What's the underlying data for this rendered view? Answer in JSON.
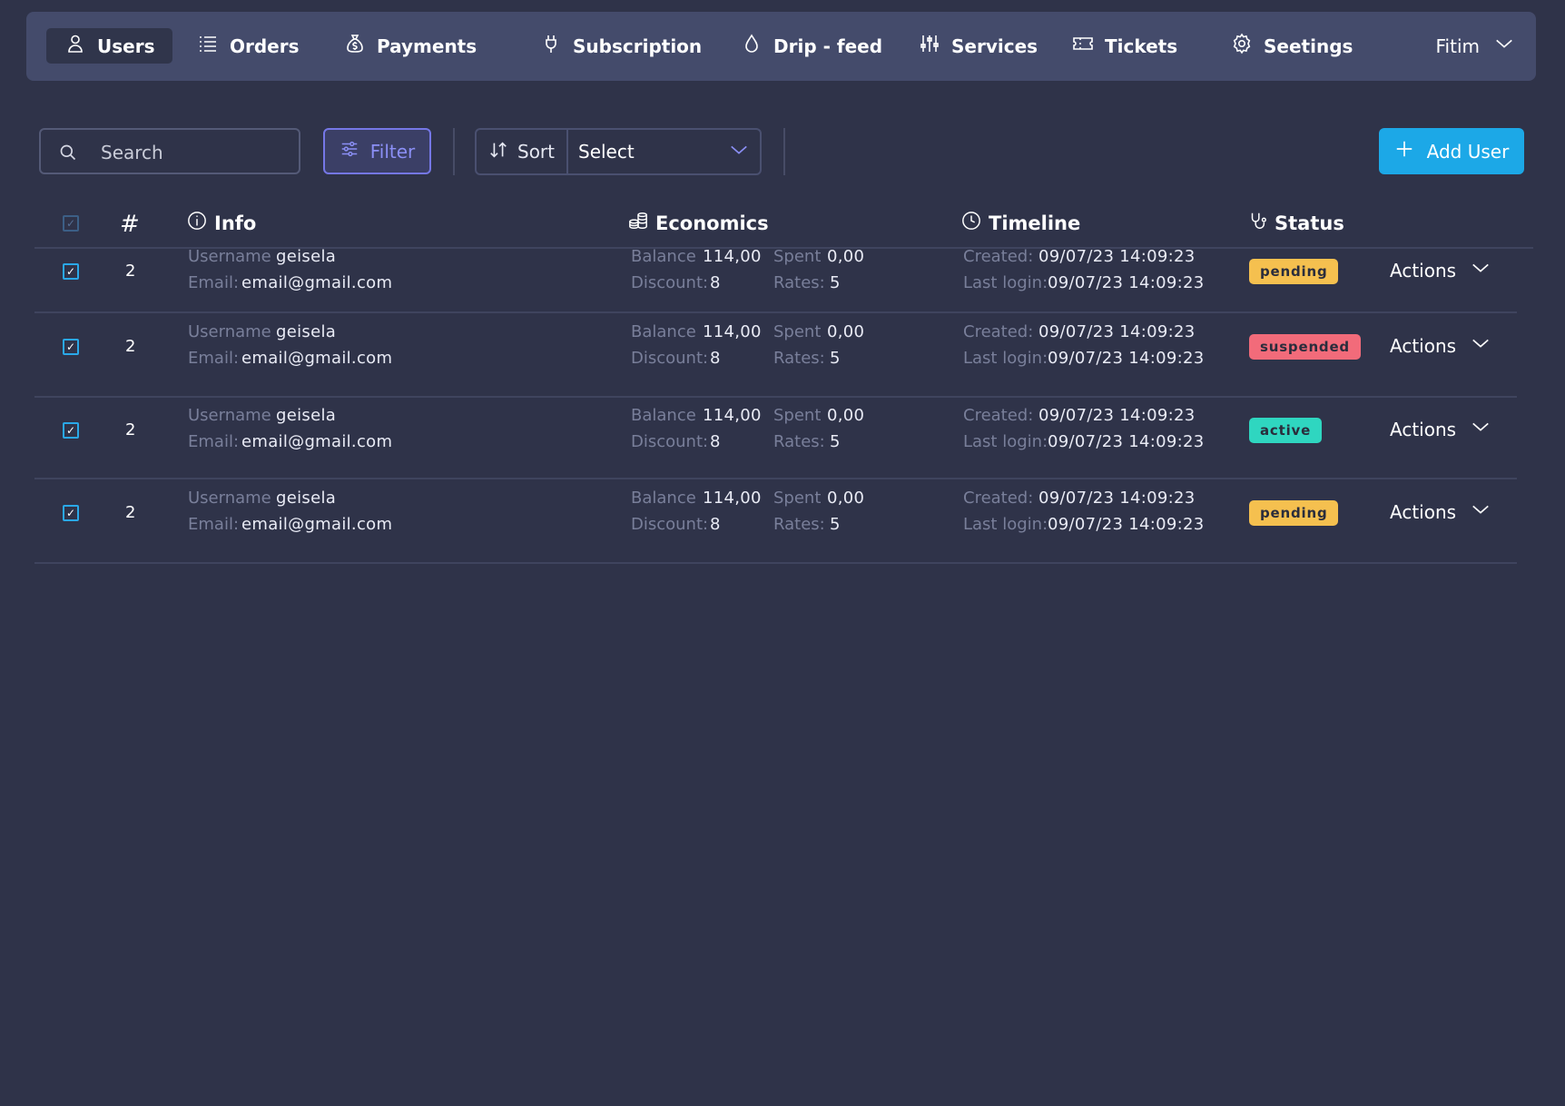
{
  "nav": {
    "items": [
      {
        "label": "Users",
        "icon": "user-icon"
      },
      {
        "label": "Orders",
        "icon": "list-icon"
      },
      {
        "label": "Payments",
        "icon": "money-bag-icon"
      },
      {
        "label": "Subscription",
        "icon": "plug-icon"
      },
      {
        "label": "Drip - feed",
        "icon": "drop-icon"
      },
      {
        "label": "Services",
        "icon": "sliders-icon"
      },
      {
        "label": "Tickets",
        "icon": "ticket-icon"
      },
      {
        "label": "Seetings",
        "icon": "gear-icon"
      }
    ],
    "active_index": 0,
    "user_name": "Fitim"
  },
  "toolbar": {
    "search_placeholder": "Search",
    "filter_label": "Filter",
    "sort_label": "Sort",
    "sort_select_value": "Select",
    "add_button_label": "Add User"
  },
  "table": {
    "headers": {
      "number": "#",
      "info": "Info",
      "economics": "Economics",
      "timeline": "Timeline",
      "status": "Status"
    },
    "labels": {
      "username": "Username",
      "email": "Email:",
      "balance": "Balance",
      "discount": "Discount:",
      "spent": "Spent",
      "rates": "Rates:",
      "created": "Created:",
      "last_login": "Last login:",
      "actions": "Actions"
    },
    "rows": [
      {
        "id": "2",
        "username": "geisela",
        "email": "email@gmail.com",
        "balance": "114,00",
        "discount": "8",
        "spent": "0,00",
        "rates": "5",
        "created": "09/07/23 14:09:23",
        "last_login": "09/07/23 14:09:23",
        "status": "pending",
        "checked": true
      },
      {
        "id": "2",
        "username": "geisela",
        "email": "email@gmail.com",
        "balance": "114,00",
        "discount": "8",
        "spent": "0,00",
        "rates": "5",
        "created": "09/07/23 14:09:23",
        "last_login": "09/07/23 14:09:23",
        "status": "suspended",
        "checked": true
      },
      {
        "id": "2",
        "username": "geisela",
        "email": "email@gmail.com",
        "balance": "114,00",
        "discount": "8",
        "spent": "0,00",
        "rates": "5",
        "created": "09/07/23 14:09:23",
        "last_login": "09/07/23 14:09:23",
        "status": "active",
        "checked": true
      },
      {
        "id": "2",
        "username": "geisela",
        "email": "email@gmail.com",
        "balance": "114,00",
        "discount": "8",
        "spent": "0,00",
        "rates": "5",
        "created": "09/07/23 14:09:23",
        "last_login": "09/07/23 14:09:23",
        "status": "pending",
        "checked": true
      }
    ]
  },
  "colors": {
    "background": "#2f3349",
    "navbar": "#444b6b",
    "accent": "#1ca8e7",
    "filter_accent": "#7577e6",
    "status_pending": "#f5c04f",
    "status_suspended": "#f26b7a",
    "status_active": "#2fd6c0"
  }
}
